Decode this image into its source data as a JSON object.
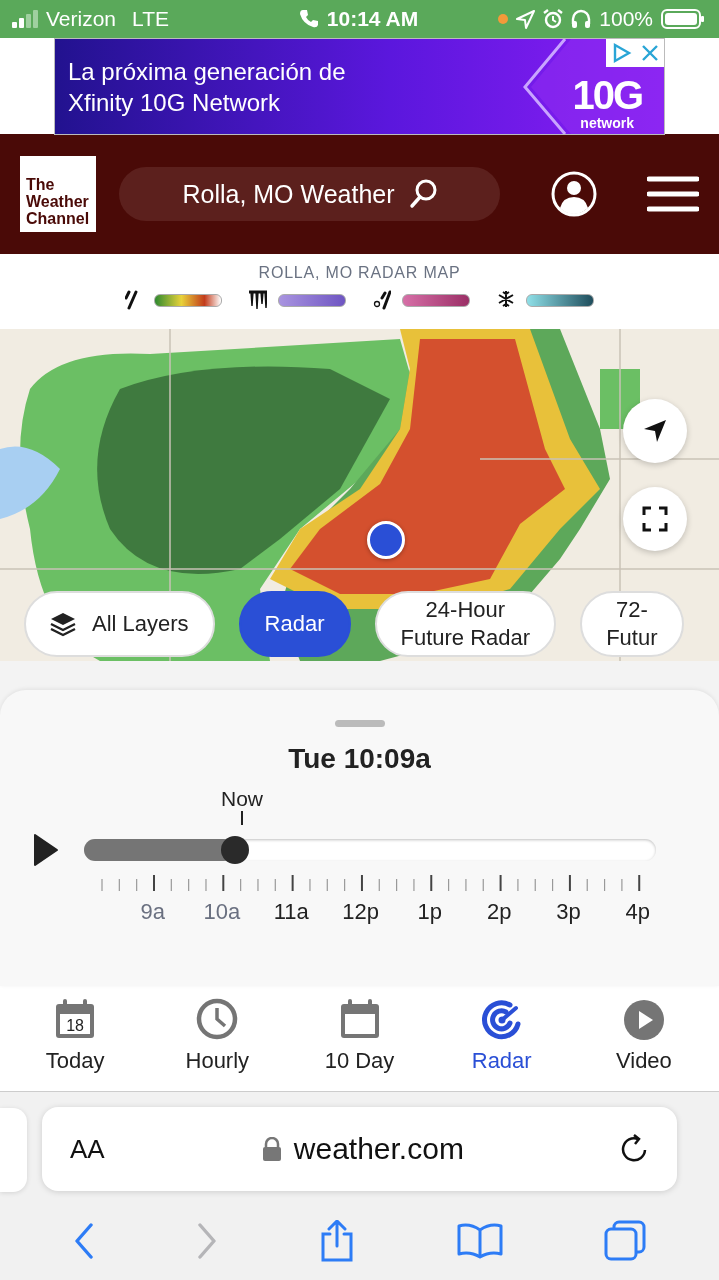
{
  "status_bar": {
    "carrier": "Verizon",
    "network": "LTE",
    "time": "10:14 AM",
    "battery": "100%"
  },
  "ad": {
    "headline": "La próxima generación de Xfinity 10G Network",
    "brand_big": "10G",
    "brand_small": "network"
  },
  "header": {
    "logo": "The Weather Channel",
    "search": "Rolla, MO Weather"
  },
  "legend": {
    "title": "ROLLA, MO RADAR MAP",
    "items": [
      {
        "kind": "rain"
      },
      {
        "kind": "ice"
      },
      {
        "kind": "mix"
      },
      {
        "kind": "snow"
      }
    ]
  },
  "map": {
    "kind": "picture",
    "chips": [
      {
        "kind": "layers",
        "label": "All Layers",
        "selected": false
      },
      {
        "kind": "text",
        "label": "Radar",
        "selected": true
      },
      {
        "kind": "text",
        "label": "24-Hour\nFuture Radar",
        "selected": false
      },
      {
        "kind": "text",
        "label": "72-\nFutur",
        "selected": false
      }
    ]
  },
  "timeline": {
    "title": "Tue 10:09a",
    "now_label": "Now",
    "level": 0.264,
    "hours": [
      {
        "label": "9a",
        "past": true
      },
      {
        "label": "10a",
        "past": true
      },
      {
        "label": "11a",
        "past": false
      },
      {
        "label": "12p",
        "past": false
      },
      {
        "label": "1p",
        "past": false
      },
      {
        "label": "2p",
        "past": false
      },
      {
        "label": "3p",
        "past": false
      },
      {
        "label": "4p",
        "past": false
      }
    ]
  },
  "nav": [
    {
      "kind": "today",
      "label": "Today",
      "icon_text": "18",
      "selected": false
    },
    {
      "kind": "hourly",
      "label": "Hourly",
      "selected": false
    },
    {
      "kind": "tenday",
      "label": "10 Day",
      "selected": false
    },
    {
      "kind": "radar",
      "label": "Radar",
      "selected": true
    },
    {
      "kind": "video",
      "label": "Video",
      "selected": false
    }
  ],
  "browser": {
    "text_size": "AA",
    "url": "weather.com"
  }
}
